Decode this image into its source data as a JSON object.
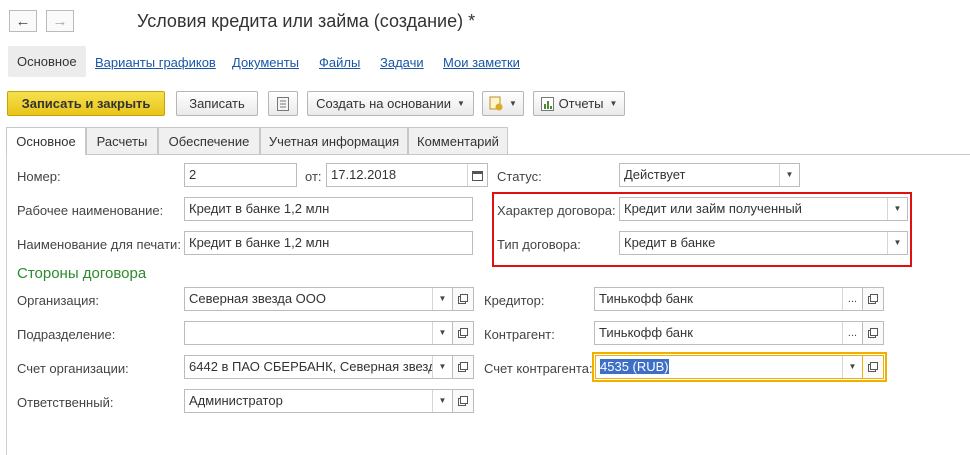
{
  "window": {
    "title": "Условия кредита или займа (создание) *"
  },
  "nav_tabs": [
    "Основное",
    "Варианты графиков",
    "Документы",
    "Файлы",
    "Задачи",
    "Мои заметки"
  ],
  "toolbar": {
    "save_close": "Записать и закрыть",
    "save": "Записать",
    "create_based": "Создать на основании",
    "reports": "Отчеты"
  },
  "form_tabs": [
    "Основное",
    "Расчеты",
    "Обеспечение",
    "Учетная информация",
    "Комментарий"
  ],
  "fields": {
    "number": {
      "label": "Номер:",
      "value": "2"
    },
    "date": {
      "label": "от:",
      "value": "17.12.2018"
    },
    "status": {
      "label": "Статус:",
      "value": "Действует"
    },
    "work_name": {
      "label": "Рабочее наименование:",
      "value": "Кредит в банке 1,2 млн"
    },
    "print_name": {
      "label": "Наименование для печати:",
      "value": "Кредит в банке 1,2 млн"
    },
    "contract_nature": {
      "label": "Характер договора:",
      "value": "Кредит или займ полученный"
    },
    "contract_type": {
      "label": "Тип договора:",
      "value": "Кредит в банке"
    }
  },
  "parties": {
    "section_title": "Стороны договора",
    "organization": {
      "label": "Организация:",
      "value": "Северная звезда ООО"
    },
    "department": {
      "label": "Подразделение:",
      "value": ""
    },
    "org_account": {
      "label": "Счет организации:",
      "value": "6442 в ПАО СБЕРБАНК, Северная звезд"
    },
    "responsible": {
      "label": "Ответственный:",
      "value": "Администратор"
    },
    "creditor": {
      "label": "Кредитор:",
      "value": "Тинькофф банк"
    },
    "counterparty": {
      "label": "Контрагент:",
      "value": "Тинькофф банк"
    },
    "counterparty_account": {
      "label": "Счет контрагента:",
      "value": "4535 (RUB)"
    }
  },
  "colors": {
    "accent_yellow": "#f0d12a",
    "highlight_red": "#e01010",
    "focus_orange": "#f1b000",
    "section_green": "#2d8a2d",
    "link_blue": "#1a56a6"
  },
  "icons": [
    "back-arrow-icon",
    "forward-arrow-icon",
    "list-icon",
    "document-add-icon",
    "report-icon",
    "dropdown-icon",
    "open-icon",
    "calendar-icon"
  ]
}
